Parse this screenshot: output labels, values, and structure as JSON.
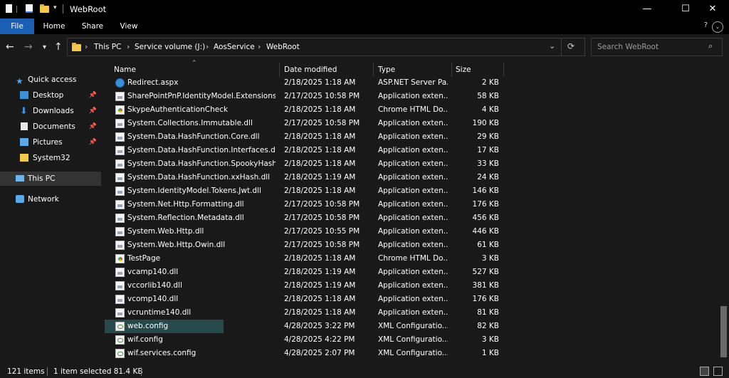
{
  "window": {
    "title": "WebRoot",
    "minimize": "—",
    "maximize": "☐",
    "close": "✕"
  },
  "ribbon": {
    "tabs": [
      "File",
      "Home",
      "Share",
      "View"
    ]
  },
  "nav": {
    "back": "←",
    "forward": "→",
    "recent": "▾",
    "up": "↑",
    "breadcrumb": [
      "This PC",
      "Service volume (J:)",
      "AosService",
      "WebRoot"
    ],
    "dropdown": "⌄",
    "refresh": "⟳",
    "search_placeholder": "Search WebRoot",
    "search_icon": "search-icon"
  },
  "sidebar": {
    "items": [
      {
        "label": "Quick access",
        "icon": "star-icon",
        "pinned": false
      },
      {
        "label": "Desktop",
        "icon": "desktop-icon",
        "pinned": true
      },
      {
        "label": "Downloads",
        "icon": "download-icon",
        "pinned": true
      },
      {
        "label": "Documents",
        "icon": "document-icon",
        "pinned": true
      },
      {
        "label": "Pictures",
        "icon": "picture-icon",
        "pinned": true
      },
      {
        "label": "System32",
        "icon": "folder-icon",
        "pinned": false
      },
      {
        "label": "This PC",
        "icon": "computer-icon",
        "pinned": false
      },
      {
        "label": "Network",
        "icon": "network-icon",
        "pinned": false
      }
    ]
  },
  "columns": {
    "name": "Name",
    "date": "Date modified",
    "type": "Type",
    "size": "Size"
  },
  "files": [
    {
      "name": "Redirect.aspx",
      "date": "2/18/2025 1:18 AM",
      "type": "ASP.NET Server Pa...",
      "size": "2 KB",
      "icon": "aspx"
    },
    {
      "name": "SharePointPnP.IdentityModel.Extensions....",
      "date": "2/17/2025 10:58 PM",
      "type": "Application exten...",
      "size": "58 KB",
      "icon": "dll"
    },
    {
      "name": "SkypeAuthenticationCheck",
      "date": "2/18/2025 1:18 AM",
      "type": "Chrome HTML Do...",
      "size": "4 KB",
      "icon": "chrome"
    },
    {
      "name": "System.Collections.Immutable.dll",
      "date": "2/17/2025 10:58 PM",
      "type": "Application exten...",
      "size": "190 KB",
      "icon": "dll"
    },
    {
      "name": "System.Data.HashFunction.Core.dll",
      "date": "2/18/2025 1:18 AM",
      "type": "Application exten...",
      "size": "29 KB",
      "icon": "dll"
    },
    {
      "name": "System.Data.HashFunction.Interfaces.dll",
      "date": "2/18/2025 1:18 AM",
      "type": "Application exten...",
      "size": "17 KB",
      "icon": "dll"
    },
    {
      "name": "System.Data.HashFunction.SpookyHash....",
      "date": "2/18/2025 1:18 AM",
      "type": "Application exten...",
      "size": "33 KB",
      "icon": "dll"
    },
    {
      "name": "System.Data.HashFunction.xxHash.dll",
      "date": "2/18/2025 1:19 AM",
      "type": "Application exten...",
      "size": "24 KB",
      "icon": "dll"
    },
    {
      "name": "System.IdentityModel.Tokens.Jwt.dll",
      "date": "2/18/2025 1:18 AM",
      "type": "Application exten...",
      "size": "146 KB",
      "icon": "dll"
    },
    {
      "name": "System.Net.Http.Formatting.dll",
      "date": "2/17/2025 10:58 PM",
      "type": "Application exten...",
      "size": "176 KB",
      "icon": "dll"
    },
    {
      "name": "System.Reflection.Metadata.dll",
      "date": "2/17/2025 10:58 PM",
      "type": "Application exten...",
      "size": "456 KB",
      "icon": "dll"
    },
    {
      "name": "System.Web.Http.dll",
      "date": "2/17/2025 10:55 PM",
      "type": "Application exten...",
      "size": "446 KB",
      "icon": "dll"
    },
    {
      "name": "System.Web.Http.Owin.dll",
      "date": "2/17/2025 10:58 PM",
      "type": "Application exten...",
      "size": "61 KB",
      "icon": "dll"
    },
    {
      "name": "TestPage",
      "date": "2/18/2025 1:18 AM",
      "type": "Chrome HTML Do...",
      "size": "3 KB",
      "icon": "chrome"
    },
    {
      "name": "vcamp140.dll",
      "date": "2/18/2025 1:19 AM",
      "type": "Application exten...",
      "size": "527 KB",
      "icon": "dll"
    },
    {
      "name": "vccorlib140.dll",
      "date": "2/18/2025 1:19 AM",
      "type": "Application exten...",
      "size": "381 KB",
      "icon": "dll"
    },
    {
      "name": "vcomp140.dll",
      "date": "2/18/2025 1:18 AM",
      "type": "Application exten...",
      "size": "176 KB",
      "icon": "dll"
    },
    {
      "name": "vcruntime140.dll",
      "date": "2/18/2025 1:18 AM",
      "type": "Application exten...",
      "size": "81 KB",
      "icon": "dll"
    },
    {
      "name": "web.config",
      "date": "4/28/2025 3:22 PM",
      "type": "XML Configuratio...",
      "size": "82 KB",
      "icon": "xml",
      "selected": true
    },
    {
      "name": "wif.config",
      "date": "4/28/2025 4:22 PM",
      "type": "XML Configuratio...",
      "size": "3 KB",
      "icon": "xml"
    },
    {
      "name": "wif.services.config",
      "date": "4/28/2025 2:07 PM",
      "type": "XML Configuratio...",
      "size": "1 KB",
      "icon": "xml"
    }
  ],
  "status": {
    "count": "121 items",
    "selection": "1 item selected  81.4 KB"
  },
  "colors": {
    "background": "#191919",
    "selected": "#27494b",
    "file_tab": "#1a5fb4"
  }
}
